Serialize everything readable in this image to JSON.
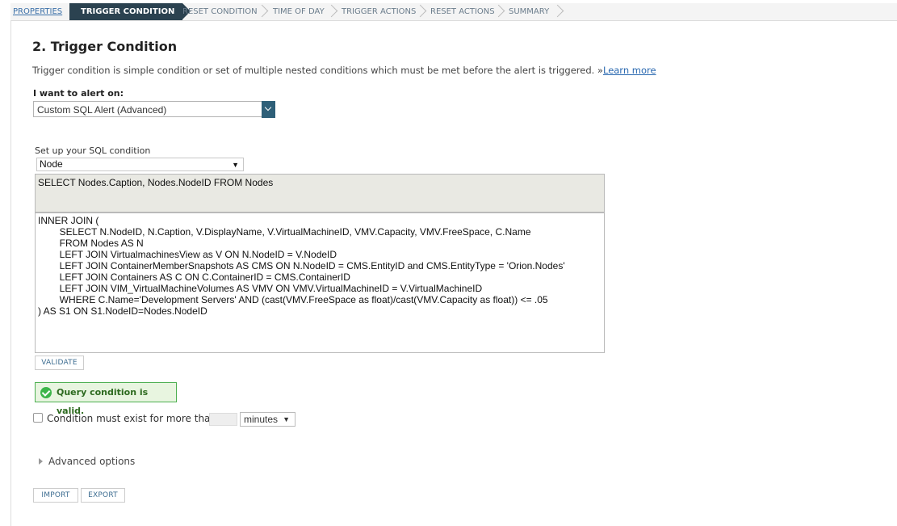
{
  "breadcrumb": {
    "steps": [
      {
        "label": "PROPERTIES"
      },
      {
        "label": "TRIGGER CONDITION"
      },
      {
        "label": "RESET CONDITION"
      },
      {
        "label": "TIME OF DAY"
      },
      {
        "label": "TRIGGER ACTIONS"
      },
      {
        "label": "RESET ACTIONS"
      },
      {
        "label": "SUMMARY"
      }
    ],
    "active_index": 1
  },
  "page": {
    "title": "2. Trigger Condition",
    "description": "Trigger condition is simple condition or set of multiple nested conditions which must be met before the alert is triggered. »",
    "learn_more": "Learn more"
  },
  "alert_on": {
    "label": "I want to alert on:",
    "value": "Custom SQL Alert (Advanced)"
  },
  "sql": {
    "label": "Set up your SQL condition",
    "object_type": "Node",
    "select_statement": "SELECT Nodes.Caption, Nodes.NodeID FROM Nodes",
    "body_lines": [
      "INNER JOIN (",
      "        SELECT N.NodeID, N.Caption, V.DisplayName, V.VirtualMachineID, VMV.Capacity, VMV.FreeSpace, C.Name",
      "        FROM Nodes AS N",
      "        LEFT JOIN VirtualmachinesView as V ON N.NodeID = V.NodeID",
      "        LEFT JOIN ContainerMemberSnapshots AS CMS ON N.NodeID = CMS.EntityID and CMS.EntityType = 'Orion.Nodes'",
      "        LEFT JOIN Containers AS C ON C.ContainerID = CMS.ContainerID",
      "        LEFT JOIN VIM_VirtualMachineVolumes AS VMV ON VMV.VirtualMachineID = V.VirtualMachineID",
      "        WHERE C.Name='Development Servers' AND (cast(VMV.FreeSpace as float)/cast(VMV.Capacity as float)) <= .05",
      ") AS S1 ON S1.NodeID=Nodes.NodeID"
    ]
  },
  "buttons": {
    "validate": "VALIDATE",
    "import": "IMPORT",
    "export": "EXPORT"
  },
  "validation": {
    "message": "Query condition is valid.",
    "color": "#3cb54a"
  },
  "duration": {
    "label": "Condition must exist for more than",
    "value": "",
    "unit": "minutes",
    "checked": false
  },
  "advanced": {
    "label": "Advanced options"
  },
  "colors": {
    "active_step": "#2b4250",
    "link": "#2968b0",
    "dropdown_accent": "#2e5f78"
  }
}
